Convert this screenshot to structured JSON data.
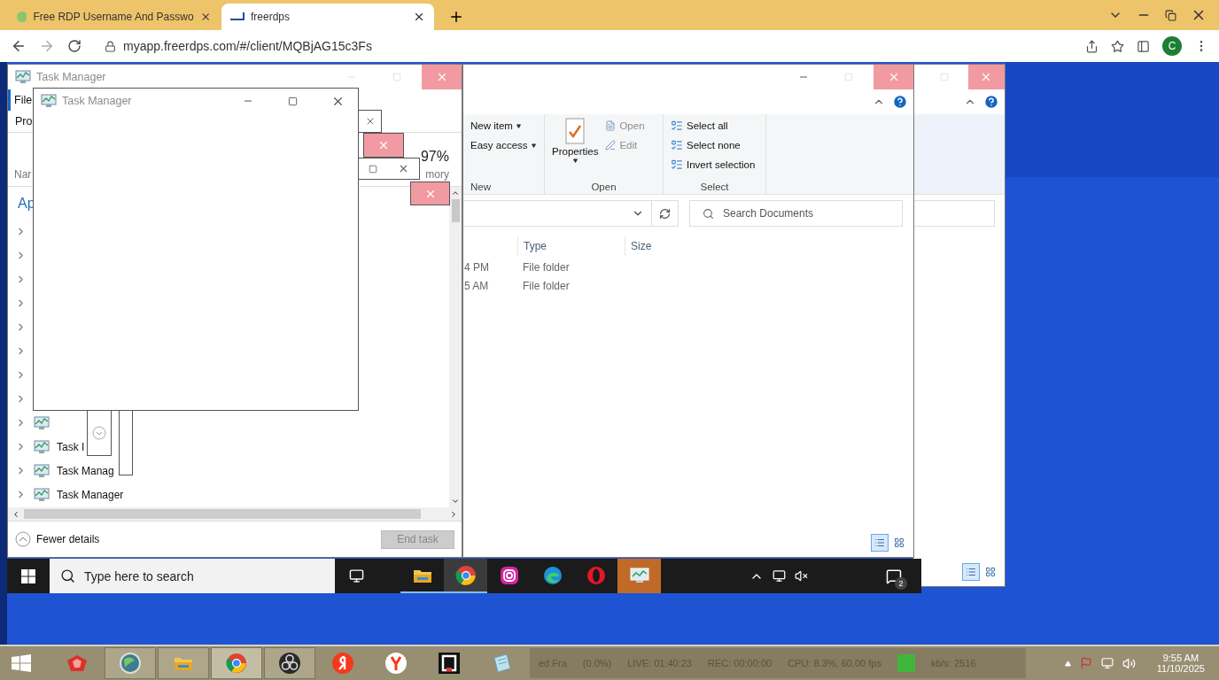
{
  "browser": {
    "tabs": [
      {
        "title": "Free RDP Username And Passwo",
        "selected": false
      },
      {
        "title": "freerdps",
        "selected": true
      }
    ],
    "url": "myapp.freerdps.com/#/client/MQBjAG15c3Fs",
    "profile_initial": "C"
  },
  "task_manager": {
    "title": "Task Manager",
    "menu": [
      "File"
    ],
    "tabs": [
      "Pro"
    ],
    "name_column": "Nar",
    "cpu_percent": "97%",
    "memory_column": "mory",
    "group": "Ap",
    "rows": [
      {
        "label": "Task I"
      },
      {
        "label": "Task Manag"
      },
      {
        "label": "Task Manager"
      }
    ],
    "fewer_details": "Fewer details",
    "end_task": {
      "label": "End task",
      "disabled": true
    }
  },
  "task_manager_front": {
    "title": "Task Manager"
  },
  "explorer": {
    "new_group": {
      "label": "New",
      "items": [
        "New item",
        "Easy access"
      ]
    },
    "open_group": {
      "label": "Open",
      "properties": "Properties",
      "items": [
        {
          "label": "Open",
          "disabled": true
        },
        {
          "label": "Edit",
          "disabled": true
        }
      ]
    },
    "select_group": {
      "label": "Select",
      "items": [
        "Select all",
        "Select none",
        "Invert selection"
      ]
    },
    "search_placeholder": "Search Documents",
    "columns": [
      "Type",
      "Size"
    ],
    "rows": [
      {
        "modified": "4 PM",
        "type": "File folder"
      },
      {
        "modified": "5 AM",
        "type": "File folder"
      }
    ],
    "views": [
      {
        "kind": "details",
        "selected": true
      },
      {
        "kind": "tiles",
        "selected": false
      }
    ]
  },
  "remote_taskbar": {
    "search_placeholder": "Type here to search",
    "apps": [
      {
        "kind": "explorer",
        "running": true,
        "selected": false,
        "flashing": false
      },
      {
        "kind": "chrome",
        "running": true,
        "selected": true,
        "flashing": false
      },
      {
        "kind": "instagram",
        "running": false,
        "selected": false,
        "flashing": false
      },
      {
        "kind": "edge",
        "running": false,
        "selected": false,
        "flashing": false
      },
      {
        "kind": "opera",
        "running": false,
        "selected": false,
        "flashing": false
      },
      {
        "kind": "taskmanager",
        "running": false,
        "selected": false,
        "flashing": true
      }
    ],
    "notifications": "2"
  },
  "host_taskbar": {
    "apps": [
      {
        "kind": "redapp",
        "running": false,
        "selected": false
      },
      {
        "kind": "globe",
        "running": true,
        "selected": false
      },
      {
        "kind": "explorer",
        "running": true,
        "selected": false
      },
      {
        "kind": "chrome",
        "running": true,
        "selected": true
      },
      {
        "kind": "obs",
        "running": true,
        "selected": false
      },
      {
        "kind": "redcircle",
        "running": false,
        "selected": false
      },
      {
        "kind": "whitecircle",
        "running": false,
        "selected": false
      },
      {
        "kind": "blackbox",
        "running": false,
        "selected": false
      },
      {
        "kind": "notepad",
        "running": false,
        "selected": false
      }
    ],
    "obs_status": [
      "ed Fra",
      "(0.0%)",
      "LIVE: 01:40:23",
      "REC: 00:00:00",
      "CPU: 8.3%, 60.00 fps",
      "kb/s: 2516"
    ],
    "time": "9:55 AM",
    "date": "11/10/2025"
  }
}
